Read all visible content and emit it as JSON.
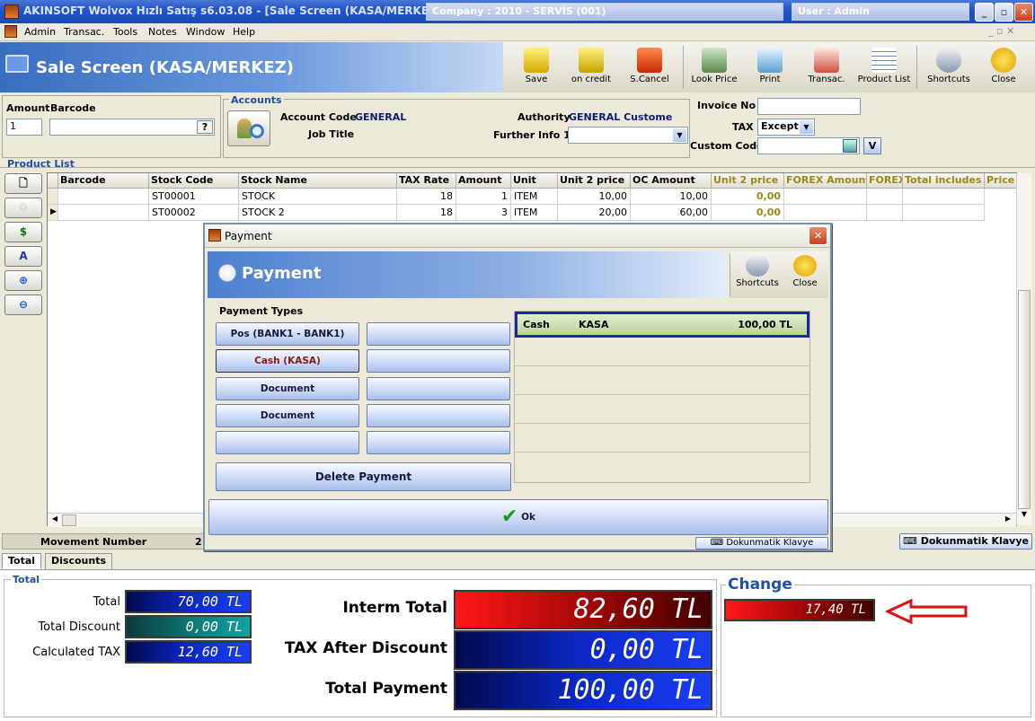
{
  "window": {
    "title": "AKINSOFT Wolvox Hızlı Satış s6.03.08 - [Sale Screen (KASA/MERKEZ)]",
    "company": "Company : 2010 - SERVİS (001)",
    "user": "User : Admin"
  },
  "menu": [
    "Admin",
    "Transac.",
    "Tools",
    "Notes",
    "Window",
    "Help"
  ],
  "header": {
    "title": "Sale Screen (KASA/MERKEZ)"
  },
  "toolbar": [
    "Save",
    "on credit",
    "S.Cancel",
    "Look Price",
    "Print",
    "Transac.",
    "Product List",
    "Shortcuts",
    "Close"
  ],
  "entry": {
    "amount_label": "Amount",
    "amount_value": "1",
    "barcode_label": "Barcode",
    "barcode_value": "",
    "help_btn": "?"
  },
  "accounts": {
    "title": "Accounts",
    "account_code_label": "Account Code",
    "account_code_value": "GENERAL",
    "authority_label": "Authority",
    "authority_value": "GENERAL Custome",
    "job_title_label": "Job Title",
    "further_info_label": "Further Info 1"
  },
  "invoice": {
    "invoice_no_label": "Invoice No",
    "tax_label": "TAX",
    "tax_value": "Except",
    "custom_code_label": "Custom Code",
    "v_btn": "V"
  },
  "product_list": {
    "title": "Product List",
    "columns": [
      "Barcode",
      "Stock Code",
      "Stock Name",
      "TAX Rate",
      "Amount",
      "Unit",
      "Unit 2 price",
      "OC Amount",
      "Unit 2 price",
      "FOREX Amount",
      "FOREX",
      "Total includes",
      "Price"
    ],
    "rows": [
      [
        "",
        "ST00001",
        "STOCK",
        "18",
        "1",
        "ITEM",
        "10,00",
        "10,00",
        "0,00"
      ],
      [
        "",
        "ST00002",
        "STOCK 2",
        "18",
        "3",
        "ITEM",
        "20,00",
        "60,00",
        "0,00"
      ]
    ]
  },
  "payment": {
    "window_title": "Payment",
    "header": "Payment",
    "shortcuts": "Shortcuts",
    "close": "Close",
    "types_label": "Payment Types",
    "type_buttons": [
      "Pos (BANK1 - BANK1)",
      "",
      "Cash (KASA)",
      "",
      "Document",
      "",
      "Document",
      "",
      "",
      ""
    ],
    "delete_btn": "Delete Payment",
    "ok_btn": "Ok",
    "keyboard_btn": "Dokunmatik Klavye",
    "entries": [
      {
        "type": "Cash",
        "account": "KASA",
        "amount": "100,00 TL"
      }
    ]
  },
  "status": {
    "movement_label": "Movement Number",
    "movement_value": "2",
    "keyboard_btn": "Dokunmatik Klavye"
  },
  "tabs": [
    "Total",
    "Discounts"
  ],
  "totals": {
    "group_label": "Total",
    "total_label": "Total",
    "total_value": "70,00 TL",
    "discount_label": "Total Discount",
    "discount_value": "0,00 TL",
    "tax_label": "Calculated TAX",
    "tax_value": "12,60 TL",
    "interm_label": "Interm Total",
    "interm_value": "82,60 TL",
    "tax_after_label": "TAX After Discount",
    "tax_after_value": "0,00 TL",
    "payment_label": "Total Payment",
    "payment_value": "100,00 TL",
    "change_label": "Change",
    "change_value": "17,40 TL"
  }
}
